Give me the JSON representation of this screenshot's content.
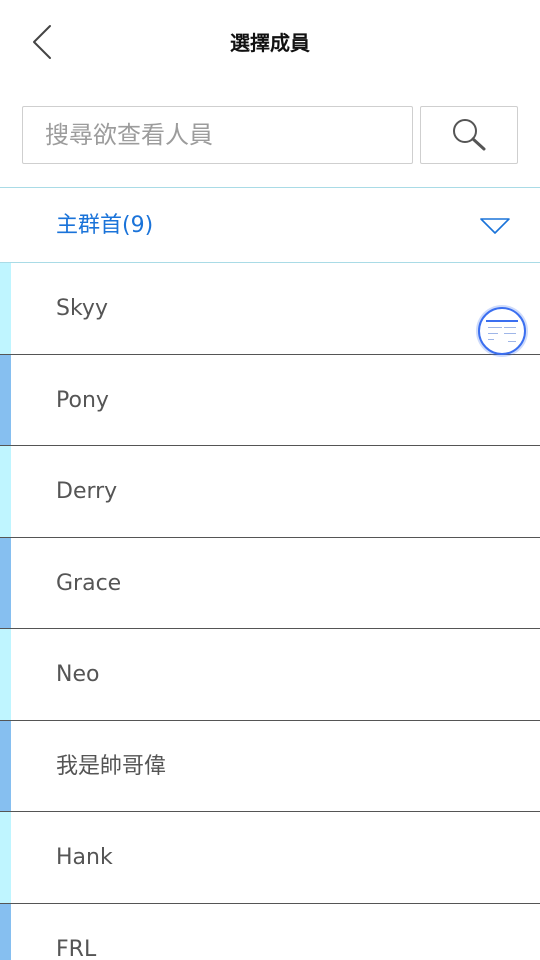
{
  "header": {
    "title": "選擇成員",
    "back_icon": "chevron-left-icon"
  },
  "search": {
    "placeholder": "搜尋欲查看人員",
    "value": "",
    "button_icon": "search-icon"
  },
  "group": {
    "title": "主群首(9)",
    "toggle_icon": "triangle-down-icon",
    "color": "#1a73d9"
  },
  "members": [
    {
      "name": "Skyy",
      "bar_color": "#bff5ff"
    },
    {
      "name": "Pony",
      "bar_color": "#86bff0"
    },
    {
      "name": "Derry",
      "bar_color": "#bff5ff"
    },
    {
      "name": "Grace",
      "bar_color": "#86bff0"
    },
    {
      "name": "Neo",
      "bar_color": "#bff5ff"
    },
    {
      "name": "我是帥哥偉",
      "bar_color": "#86bff0"
    },
    {
      "name": "Hank",
      "bar_color": "#bff5ff"
    },
    {
      "name": "FRL",
      "bar_color": "#86bff0"
    }
  ],
  "float_button": {
    "icon": "assistive-touch-icon",
    "accent": "#3b6ff0"
  }
}
